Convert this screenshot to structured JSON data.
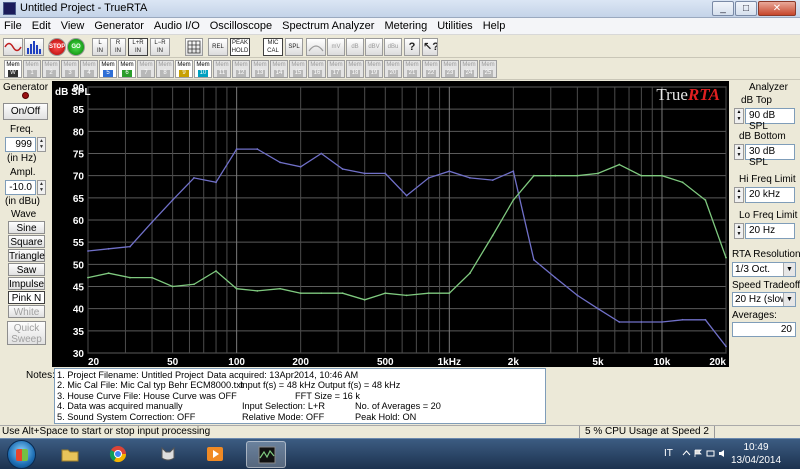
{
  "window": {
    "title": "Untitled Project - TrueRTA",
    "min": "_",
    "max": "□",
    "close": "✕"
  },
  "menu": [
    "File",
    "Edit",
    "View",
    "Generator",
    "Audio I/O",
    "Oscilloscope",
    "Spectrum Analyzer",
    "Metering",
    "Utilities",
    "Help"
  ],
  "toolbar": {
    "buttons": [
      "sine-wave",
      "rta",
      "stop",
      "go",
      "L IN",
      "R IN",
      "L+R IN",
      "L-R IN",
      "grid",
      "REL",
      "PEAK HOLD",
      "MIC CAL",
      "SPL",
      "curve",
      "mV",
      "dB",
      "dBV",
      "dBu",
      "help",
      "context-help"
    ]
  },
  "memories": {
    "label": "Mem",
    "items": [
      "W",
      "1",
      "2",
      "3",
      "4",
      "5",
      "6",
      "7",
      "8",
      "9",
      "10",
      "11",
      "12",
      "13",
      "14",
      "15",
      "16",
      "17",
      "18",
      "19",
      "20",
      "21",
      "22",
      "23",
      "24",
      "25"
    ],
    "active": [
      "W",
      "5",
      "6",
      "9",
      "10"
    ],
    "colors": {
      "5": "#2f6fd6",
      "6": "#2a9d2a",
      "9": "#c8a000",
      "10": "#00a0c0"
    }
  },
  "generator": {
    "title": "Generator",
    "onoff": "On/Off",
    "freq_label": "Freq.",
    "freq_value": "999",
    "freq_unit": "(in Hz)",
    "ampl_label": "Ampl.",
    "ampl_value": "-10.0",
    "ampl_unit": "(in dBu)",
    "wave_title": "Wave",
    "waves": [
      "Sine",
      "Square",
      "Triangle",
      "Saw",
      "Impulse",
      "Pink N",
      "White N"
    ],
    "selected_wave": "Pink N",
    "quick_sweep": "Quick Sweep"
  },
  "analyzer": {
    "title": "Analyzer",
    "db_top_label": "dB Top",
    "db_top": "90 dB SPL",
    "db_bottom_label": "dB Bottom",
    "db_bottom": "30 dB SPL",
    "hi_freq_label": "Hi Freq Limit",
    "hi_freq": "20 kHz",
    "lo_freq_label": "Lo Freq Limit",
    "lo_freq": "20 Hz",
    "resolution_label": "RTA Resolution:",
    "resolution": "1/3 Oct.",
    "speed_label": "Speed Tradeoff:",
    "speed": "20 Hz (slow)",
    "averages_label": "Averages:",
    "averages": "20"
  },
  "chart_data": {
    "type": "line",
    "ylabel": "dB SPL",
    "brand": "TrueRTA",
    "ylim": [
      30,
      90
    ],
    "y_ticks": [
      30,
      35,
      40,
      45,
      50,
      55,
      60,
      65,
      70,
      75,
      80,
      85,
      90
    ],
    "xlim": [
      20,
      20000
    ],
    "x_scale": "log",
    "x_ticks": [
      {
        "v": 20,
        "label": "20"
      },
      {
        "v": 50,
        "label": "50"
      },
      {
        "v": 100,
        "label": "100"
      },
      {
        "v": 200,
        "label": "200"
      },
      {
        "v": 500,
        "label": "500"
      },
      {
        "v": 1000,
        "label": "1kHz"
      },
      {
        "v": 2000,
        "label": "2k"
      },
      {
        "v": 5000,
        "label": "5k"
      },
      {
        "v": 10000,
        "label": "10k"
      },
      {
        "v": 20000,
        "label": "20k"
      }
    ],
    "series": [
      {
        "color": "#7070c8",
        "x": [
          20,
          25,
          31.5,
          40,
          50,
          63,
          80,
          100,
          125,
          160,
          200,
          250,
          315,
          400,
          500,
          630,
          800,
          1000,
          1250,
          1600,
          2000,
          2500,
          3150,
          4000,
          5000,
          6300,
          8000,
          10000,
          12500,
          16000,
          20000
        ],
        "values": [
          53,
          53.5,
          54,
          59.5,
          64.5,
          69.5,
          68.5,
          76,
          76,
          73,
          72,
          75,
          71.5,
          70.5,
          70.5,
          65.5,
          69.5,
          71,
          69.5,
          69,
          71,
          51,
          47,
          43,
          40,
          37,
          37,
          37,
          37.5,
          37.5,
          31.5
        ]
      },
      {
        "color": "#7fc97f",
        "x": [
          20,
          25,
          31.5,
          40,
          50,
          63,
          80,
          100,
          125,
          160,
          200,
          250,
          315,
          400,
          500,
          630,
          800,
          1000,
          1250,
          1600,
          2000,
          2500,
          3150,
          4000,
          5000,
          6300,
          8000,
          10000,
          12500,
          16000,
          20000
        ],
        "values": [
          47,
          48,
          47,
          47,
          45,
          45.5,
          48.5,
          44.5,
          44,
          44.5,
          43.5,
          43.5,
          43.5,
          42,
          43.5,
          43,
          43.5,
          43.5,
          48,
          56.5,
          64.5,
          70,
          70,
          70,
          70.5,
          72.5,
          70,
          70,
          68.5,
          64.5,
          51.5
        ]
      }
    ],
    "grid": true
  },
  "notes": {
    "label": "Notes:",
    "rows": [
      [
        "1. Project Filename: Untitled Project",
        "Data acquired: 13Apr2014, 10:46 AM",
        ""
      ],
      [
        "2. Mic Cal File: Mic Cal typ Behr ECM8000.txt",
        "Input f(s) = 48 kHz   Output f(s) = 48 kHz",
        ""
      ],
      [
        "3. House Curve File: House Curve was OFF",
        "FFT Size = 16 k",
        ""
      ],
      [
        "4. Data was acquired manually",
        "Input Selection: L+R",
        "No. of Averages = 20"
      ],
      [
        "5. Sound System Correction: OFF",
        "Relative Mode:  OFF",
        "Peak Hold: ON"
      ]
    ]
  },
  "status": {
    "hint": "Use Alt+Space to start or stop input processing",
    "cpu": "5 % CPU Usage at Speed 2"
  },
  "taskbar": {
    "lang": "IT",
    "time": "10:49",
    "date": "13/04/2014"
  }
}
